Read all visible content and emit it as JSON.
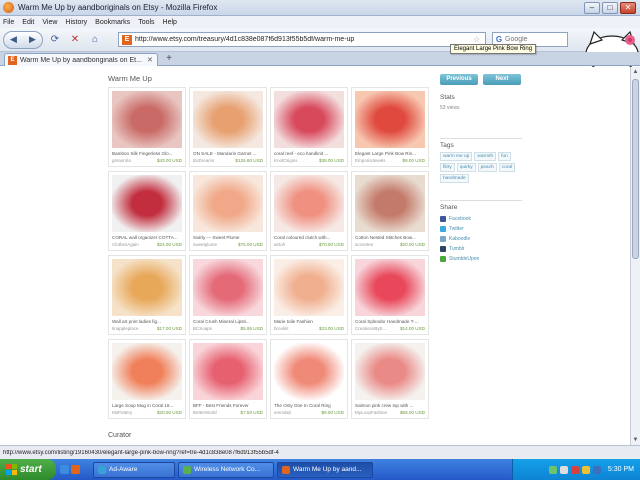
{
  "window": {
    "title": "Warm Me Up by aandboriginals on Etsy - Mozilla Firefox",
    "minimize": "–",
    "maximize": "□",
    "close": "✕"
  },
  "menu": [
    "File",
    "Edit",
    "View",
    "History",
    "Bookmarks",
    "Tools",
    "Help"
  ],
  "toolbar": {
    "url": "http://www.etsy.com/treasury/4d1c838e087f6d913f55b5df/warm-me-up",
    "search_placeholder": "Google",
    "favicon_letter": "E"
  },
  "tab": {
    "label": "Warm Me Up by aandboriginals on Et...",
    "new_tab": "+"
  },
  "page": {
    "title": "Warm Me Up",
    "prev_label": "Previous",
    "next_label": "Next",
    "curator_label": "Curator"
  },
  "items": [
    {
      "title": "Bamboo Silk Fingerless Glo...",
      "shop": "gmanrola",
      "price": "$43.00 USD",
      "colors": [
        "#c96a66",
        "#e9c6c2"
      ]
    },
    {
      "title": "ON SALE - Mandarin Garnet ...",
      "shop": "BoDreams",
      "price": "$126.60 USD",
      "colors": [
        "#e8a070",
        "#f4e8e0"
      ]
    },
    {
      "title": "coral reef - eco handknit ...",
      "shop": "KnotOrigins",
      "price": "$38.00 USD",
      "colors": [
        "#d8495c",
        "#f3dede"
      ]
    },
    {
      "title": "Elegant Large Pink Bow Rin...",
      "shop": "EmporiaJewels",
      "price": "$8.00 USD",
      "colors": [
        "#e04a3e",
        "#f7c7b0"
      ]
    },
    {
      "title": "CORAL wall organizer COTTA...",
      "shop": "ClothesAgain",
      "price": "$24.00 USD",
      "colors": [
        "#c22e3e",
        "#f0f0f0"
      ]
    },
    {
      "title": "Swirly --- Sweet Plume",
      "shop": "sweetplume",
      "price": "$75.00 USD",
      "colors": [
        "#f0a888",
        "#f8e7dc"
      ]
    },
    {
      "title": "Coral coloured clutch with...",
      "shop": "airtoh",
      "price": "$70.00 USD",
      "colors": [
        "#f09080",
        "#f6e8e4"
      ]
    },
    {
      "title": "Cotton Nested Stitches Bow...",
      "shop": "accenten",
      "price": "$20.00 USD",
      "colors": [
        "#c47a6a",
        "#e8dcd0"
      ]
    },
    {
      "title": "Wall art print ladies fig...",
      "shop": "tinappleplace",
      "price": "$17.00 USD",
      "colors": [
        "#e8a85a",
        "#f5e2c8"
      ]
    },
    {
      "title": "Coral Crush Mineral Lipsti...",
      "shop": "BCSoaps",
      "price": "$5.95 USD",
      "colors": [
        "#e46a78",
        "#f8d8dc"
      ]
    },
    {
      "title": "Marie toile Fashion",
      "shop": "brooklit",
      "price": "$23.00 USD",
      "colors": [
        "#f0b090",
        "#fbeee6"
      ]
    },
    {
      "title": "Coral Splendor Handmade T-...",
      "shop": "CreationsByE...",
      "price": "$14.00 USD",
      "colors": [
        "#e8485a",
        "#f7d5da"
      ]
    },
    {
      "title": "Large Soup Mug in Coral 16...",
      "shop": "KBPottery",
      "price": "$20.00 USD",
      "colors": [
        "#f0805a",
        "#f5f2ee"
      ]
    },
    {
      "title": "BFF - Best Friends Forever",
      "shop": "BetterWorld",
      "price": "$7.50 USD",
      "colors": [
        "#e66070",
        "#f9d4d8"
      ]
    },
    {
      "title": "The Only One In Coral Ring",
      "shop": "emmilab",
      "price": "$9.00 USD",
      "colors": [
        "#f08a78",
        "#ffffff"
      ]
    },
    {
      "title": "Salmon pink crew top with ...",
      "shop": "MyLoopFashion",
      "price": "$65.00 USD",
      "colors": [
        "#ea8a86",
        "#f4f1ee"
      ]
    }
  ],
  "sidebar": {
    "stats_label": "Stats",
    "stats_value": "53 views",
    "tags_label": "Tags",
    "tags": [
      "warm me up",
      "warmth",
      "fun",
      "flirty",
      "quirky",
      "peach",
      "coral",
      "handmade"
    ],
    "share_label": "Share",
    "share": [
      {
        "label": "Facebook",
        "color": "#3b5998"
      },
      {
        "label": "Twitter",
        "color": "#39a9e0"
      },
      {
        "label": "Kaboodle",
        "color": "#7aa7c7"
      },
      {
        "label": "Tumblr",
        "color": "#2c4762"
      },
      {
        "label": "StumbleUpon",
        "color": "#4aa83f"
      }
    ]
  },
  "tooltip": "Elegant Large Pink Bow Ring",
  "status_text": "http://www.etsy.com/listing/19160430/elegant-large-pink-bow-ring?ref=tre-4d1c838e087f6d913f55b5df-4",
  "taskbar": {
    "start_label": "start",
    "items": [
      {
        "label": "Ad-Aware",
        "color": "#3aa0d8",
        "active": false
      },
      {
        "label": "Wireless Network Co...",
        "color": "#5ab04a",
        "active": false
      },
      {
        "label": "Warm Me Up by aand...",
        "color": "#e2651d",
        "active": true
      }
    ],
    "clock": "5:30 PM"
  }
}
